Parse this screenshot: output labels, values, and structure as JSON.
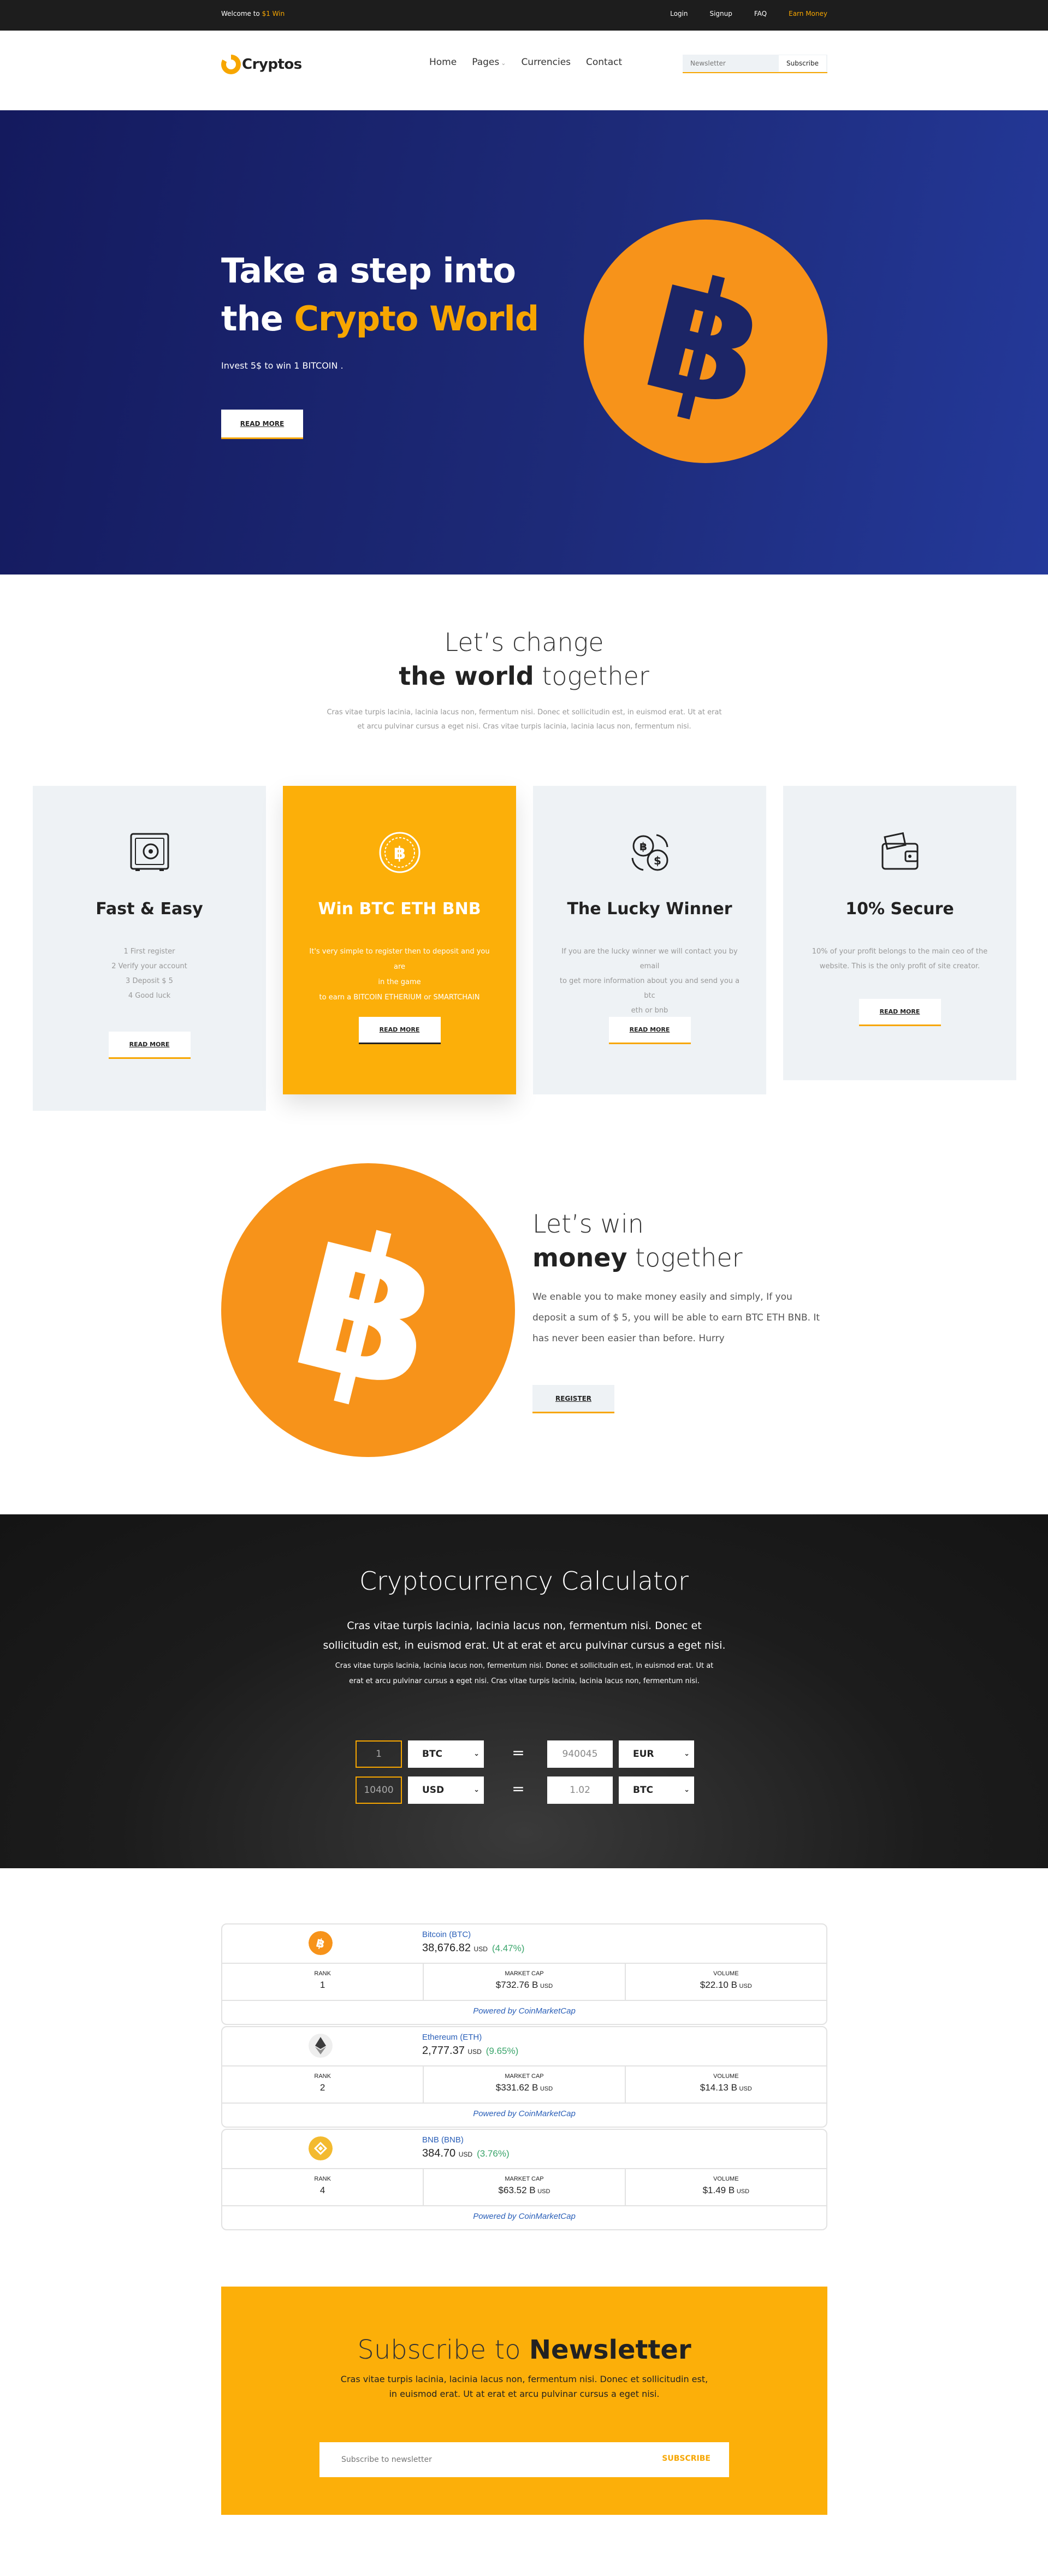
{
  "topbar": {
    "welcome_prefix": "Welcome to ",
    "welcome_highlight": "$1 Win",
    "links": [
      "Login",
      "Signup",
      "FAQ"
    ],
    "earn": "Earn Money"
  },
  "nav": {
    "logo": "Cryptos",
    "items": [
      "Home",
      "Pages",
      "Currencies",
      "Contact"
    ],
    "newsletter_placeholder": "Newsletter",
    "subscribe": "Subscribe"
  },
  "hero": {
    "line1": "Take a step into",
    "line2_plain": "the ",
    "line2_highlight": "Crypto World",
    "subtitle": "Invest 5$ to win 1 BITCOIN .",
    "button": "READ MORE"
  },
  "intro": {
    "title_line1": "Let’s change",
    "title_bold": "the world",
    "title_rest": " together",
    "text_line1": "Cras vitae turpis lacinia, lacinia lacus non, fermentum nisi. Donec et sollicitudin est, in euismod erat. Ut at erat",
    "text_line2": "et arcu pulvinar cursus a eget nisi. Cras vitae turpis lacinia, lacinia lacus non, fermentum nisi."
  },
  "features": [
    {
      "title": "Fast & Easy",
      "lines": [
        "1 First register",
        "2 Verify your account",
        "3 Deposit $ 5",
        "4 Good luck"
      ],
      "button": "READ MORE",
      "icon": "safe-icon"
    },
    {
      "title": "Win BTC ETH BNB",
      "lines": [
        "It's very simple to register then to deposit and you are",
        "in the game",
        "to earn a BITCOIN ETHERIUM or SMARTCHAIN"
      ],
      "button": "READ MORE",
      "icon": "bitcoin-coin-icon"
    },
    {
      "title": "The Lucky Winner",
      "lines": [
        "If you are the lucky winner we will contact you by email",
        "to get more information about you and send you a btc",
        "eth or bnb"
      ],
      "button": "READ MORE",
      "icon": "exchange-icon"
    },
    {
      "title": "10% Secure",
      "lines": [
        "10% of your profit belongs to the main ceo of the",
        "website. This is the only profit of site creator."
      ],
      "button": "READ MORE",
      "icon": "wallet-icon"
    }
  ],
  "win": {
    "title_line1": "Let’s win",
    "title_bold": "money",
    "title_rest": " together",
    "text": "We enable you to make money easily and simply, If you deposit a sum of $ 5, you will be able to earn BTC ETH BNB. It has never been easier than before. Hurry",
    "button": "REGISTER"
  },
  "calculator": {
    "title": "Cryptocurrency Calculator",
    "text_big": "Cras vitae turpis lacinia, lacinia lacus non, fermentum nisi. Donec et sollicitudin est, in euismod erat. Ut at erat et arcu pulvinar cursus a eget nisi.",
    "text_small": "Cras vitae turpis lacinia, lacinia lacus non, fermentum nisi. Donec et sollicitudin est, in euismod erat. Ut at erat et arcu pulvinar cursus a eget nisi. Cras vitae turpis lacinia, lacinia lacus non, fermentum nisi.",
    "rows": [
      {
        "amount": "1",
        "from": "BTC",
        "equals": "=",
        "result": "940045",
        "to": "EUR"
      },
      {
        "amount": "10400",
        "from": "USD",
        "equals": "=",
        "result": "1.02",
        "to": "BTC"
      }
    ]
  },
  "tickers": [
    {
      "name": "Bitcoin (BTC)",
      "price": "38,676.82",
      "unit": "USD",
      "change": "(4.47%)",
      "rank_label": "RANK",
      "rank": "1",
      "mcap_label": "MARKET CAP",
      "mcap": "$732.76 B",
      "vol_label": "VOLUME",
      "vol": "$22.10 B",
      "cur": "USD",
      "powered": "Powered by CoinMarketCap",
      "color": "#f7931a"
    },
    {
      "name": "Ethereum (ETH)",
      "price": "2,777.37",
      "unit": "USD",
      "change": "(9.65%)",
      "rank_label": "RANK",
      "rank": "2",
      "mcap_label": "MARKET CAP",
      "mcap": "$331.62 B",
      "vol_label": "VOLUME",
      "vol": "$14.13 B",
      "cur": "USD",
      "powered": "Powered by CoinMarketCap",
      "color": "#eeeeee"
    },
    {
      "name": "BNB (BNB)",
      "price": "384.70",
      "unit": "USD",
      "change": "(3.76%)",
      "rank_label": "RANK",
      "rank": "4",
      "mcap_label": "MARKET CAP",
      "mcap": "$63.52 B",
      "vol_label": "VOLUME",
      "vol": "$1.49 B",
      "cur": "USD",
      "powered": "Powered by CoinMarketCap",
      "color": "#f3ba2f"
    }
  ],
  "newsletter": {
    "title_plain": "Subscribe to ",
    "title_bold": "Newsletter",
    "text": "Cras vitae turpis lacinia, lacinia lacus non, fermentum nisi. Donec et sollicitudin est, in euismod erat. Ut at erat et arcu pulvinar cursus a eget nisi.",
    "placeholder": "Subscribe to newsletter",
    "button": "SUBSCRIBE"
  },
  "colors": {
    "accent": "#f7a600",
    "yellow": "#fcaf09",
    "hero_blue": "#1d2a78",
    "bitcoin": "#f7931a"
  }
}
